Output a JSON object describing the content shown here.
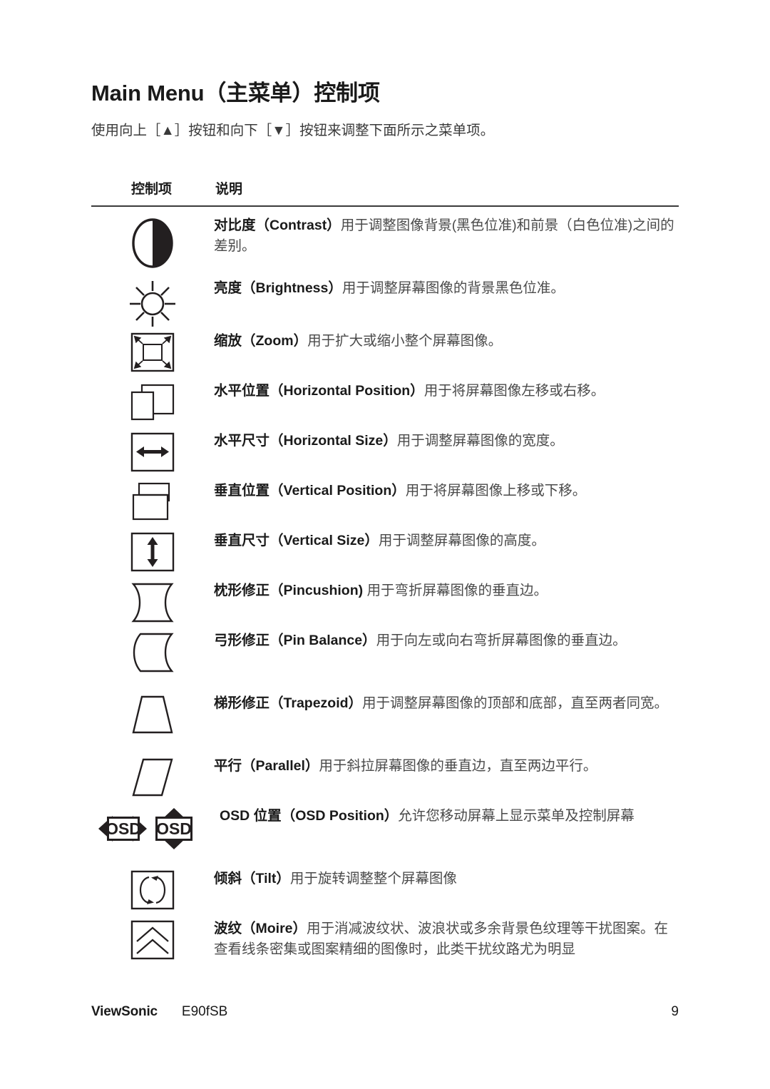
{
  "document": {
    "title": "Main Menu（主菜单）控制项",
    "intro": "使用向上［▲］按钮和向下［▼］按钮来调整下面所示之菜单项。"
  },
  "table": {
    "headers": {
      "control": "控制项",
      "description": "说明"
    },
    "rows": [
      {
        "icon": "contrast-icon",
        "term_cn": "对比度",
        "term_en": "（Contrast）",
        "description": "用于调整图像背景(黑色位准)和前景（白色位准)之间的差别。"
      },
      {
        "icon": "brightness-icon",
        "term_cn": "亮度",
        "term_en": "（Brightness）",
        "description": "用于调整屏幕图像的背景黑色位准。"
      },
      {
        "icon": "zoom-icon",
        "term_cn": "缩放",
        "term_en": "（Zoom）",
        "description": "用于扩大或缩小整个屏幕图像。"
      },
      {
        "icon": "horizontal-position-icon",
        "term_cn": "水平位置",
        "term_en": "（Horizontal Position）",
        "description": "用于将屏幕图像左移或右移。"
      },
      {
        "icon": "horizontal-size-icon",
        "term_cn": "水平尺寸",
        "term_en": "（Horizontal Size）",
        "description": "用于调整屏幕图像的宽度。"
      },
      {
        "icon": "vertical-position-icon",
        "term_cn": "垂直位置",
        "term_en": "（Vertical Position）",
        "description": "用于将屏幕图像上移或下移。"
      },
      {
        "icon": "vertical-size-icon",
        "term_cn": "垂直尺寸",
        "term_en": "（Vertical Size）",
        "description": "用于调整屏幕图像的高度。"
      },
      {
        "icon": "pincushion-icon",
        "term_cn": "枕形修正",
        "term_en": "（Pincushion)",
        "description": " 用于弯折屏幕图像的垂直边。"
      },
      {
        "icon": "pin-balance-icon",
        "term_cn": "弓形修正",
        "term_en": "（Pin Balance）",
        "description": "用于向左或向右弯折屏幕图像的垂直边。"
      },
      {
        "icon": "trapezoid-icon",
        "term_cn": "梯形修正",
        "term_en": "（Trapezoid）",
        "description": "用于调整屏幕图像的顶部和底部，直至两者同宽。"
      },
      {
        "icon": "parallel-icon",
        "term_cn": "平行",
        "term_en": "（Parallel）",
        "description": "用于斜拉屏幕图像的垂直边，直至两边平行。"
      },
      {
        "icon": "osd-position-icon",
        "term_cn": "OSD 位置",
        "term_en": "（OSD Position）",
        "description": "允许您移动屏幕上显示菜单及控制屏幕"
      },
      {
        "icon": "tilt-icon",
        "term_cn": "倾斜",
        "term_en": "（Tilt）",
        "description": "用于旋转调整整个屏幕图像"
      },
      {
        "icon": "moire-icon",
        "term_cn": "波纹",
        "term_en": "（Moire）",
        "description": "用于消减波纹状、波浪状或多余背景色纹理等干扰图案。在查看线条密集或图案精细的图像时，此类干扰纹路尤为明显"
      }
    ]
  },
  "footer": {
    "brand": "ViewSonic",
    "model": "E90fSB",
    "page_number": "9"
  }
}
